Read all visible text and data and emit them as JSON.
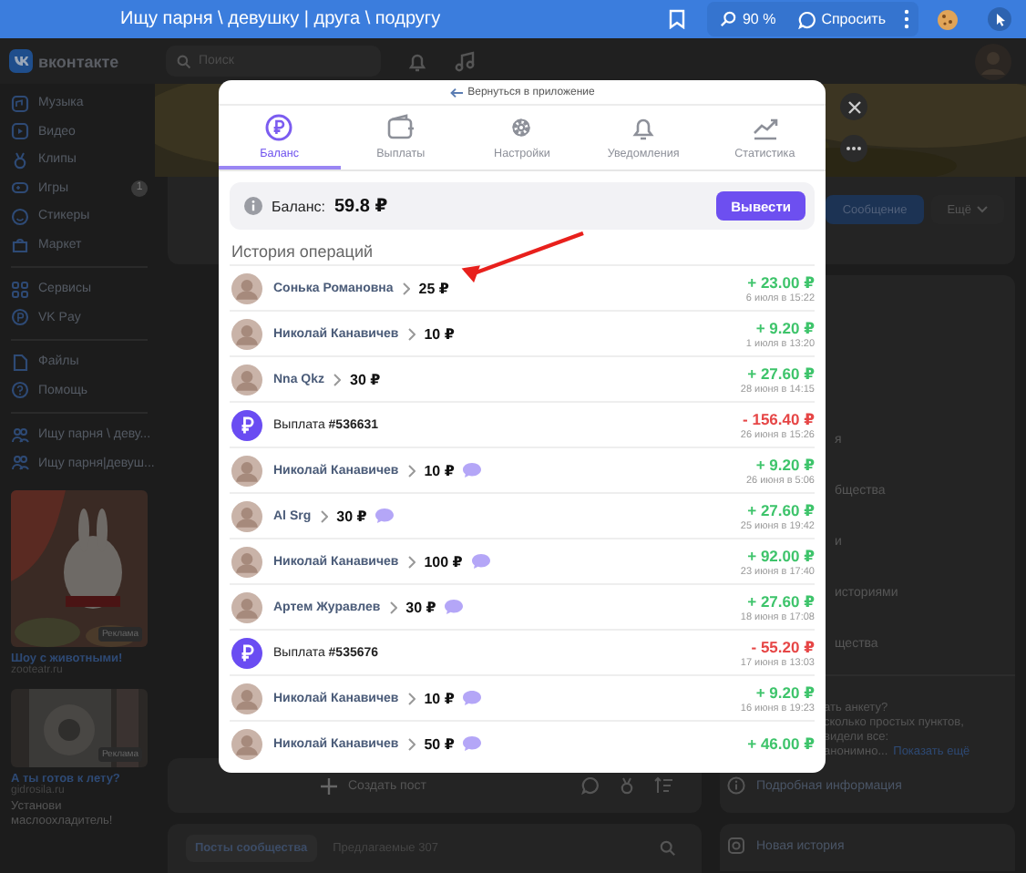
{
  "browser": {
    "title": "Ищу парня \\ девушку | друга \\ подругу",
    "zoom": "90 %",
    "ask": "Спросить"
  },
  "header": {
    "logo": "вконтакте",
    "search": {
      "placeholder": "Поиск"
    }
  },
  "sidebar": {
    "sections": [
      [
        {
          "label": "Музыка"
        },
        {
          "label": "Видео"
        },
        {
          "label": "Клипы"
        },
        {
          "label": "Игры",
          "badge": "1"
        },
        {
          "label": "Стикеры"
        },
        {
          "label": "Маркет"
        }
      ],
      [
        {
          "label": "Сервисы"
        },
        {
          "label": "VK Pay"
        }
      ],
      [
        {
          "label": "Файлы"
        },
        {
          "label": "Помощь"
        }
      ],
      [
        {
          "label": "Ищу парня \\ деву..."
        },
        {
          "label": "Ищу парня|девуш..."
        }
      ]
    ],
    "ads": [
      {
        "label": "Реклама",
        "title": "Шоу с животными!",
        "domain": "zooteatr.ru"
      },
      {
        "label": "Реклама",
        "title": "А ты готов к лету?",
        "domain": "gidrosila.ru",
        "text": "Установи маслоохладитель!"
      }
    ]
  },
  "profile": {
    "buttons": [
      {
        "label": "Сообщение",
        "kind": "primary"
      },
      {
        "label": "Ещё",
        "kind": "menu"
      }
    ]
  },
  "info_panel": {
    "lines": [
      "я",
      "бщества",
      "и",
      "историями",
      "щества"
    ],
    "about": [
      "ать анкету?",
      "сколько простых пунктов,",
      "видели все:"
    ],
    "about_last": "анонимно...",
    "more": "Показать ещё",
    "details": "Подробная информация",
    "story": "Новая история"
  },
  "feed": {
    "create": "Создать пост",
    "tabs": [
      {
        "label": "Посты сообщества",
        "selected": true
      },
      {
        "label": "Предлагаемые",
        "count": "307",
        "selected": false
      }
    ]
  },
  "modal": {
    "back": "Вернуться в приложение",
    "tabs": [
      {
        "label": "Баланс",
        "selected": true
      },
      {
        "label": "Выплаты",
        "selected": false
      },
      {
        "label": "Настройки",
        "selected": false
      },
      {
        "label": "Уведомления",
        "selected": false
      },
      {
        "label": "Статистика",
        "selected": false
      }
    ],
    "balance": {
      "label": "Баланс:",
      "value": "59.8 ₽",
      "button": "Вывести"
    },
    "history_title": "История операций",
    "operations": [
      {
        "kind": "transfer",
        "name": "Сонька Романовна",
        "sum": "25 ₽",
        "comment": false,
        "amount": "+ 23.00 ₽",
        "date": "6 июля в 15:22"
      },
      {
        "kind": "transfer",
        "name": "Николай Канавичев",
        "sum": "10 ₽",
        "comment": false,
        "amount": "+ 9.20 ₽",
        "date": "1 июля в 13:20"
      },
      {
        "kind": "transfer",
        "name": "Nna Qkz",
        "sum": "30 ₽",
        "comment": false,
        "amount": "+ 27.60 ₽",
        "date": "28 июня в 14:15"
      },
      {
        "kind": "payout",
        "title": "Выплата **#536631**",
        "amount": "- 156.40 ₽",
        "date": "26 июня в 15:26"
      },
      {
        "kind": "transfer",
        "name": "Николай Канавичев",
        "sum": "10 ₽",
        "comment": true,
        "amount": "+ 9.20 ₽",
        "date": "26 июня в 5:06"
      },
      {
        "kind": "transfer",
        "name": "Al Srg",
        "sum": "30 ₽",
        "comment": true,
        "amount": "+ 27.60 ₽",
        "date": "25 июня в 19:42"
      },
      {
        "kind": "transfer",
        "name": "Николай Канавичев",
        "sum": "100 ₽",
        "comment": true,
        "amount": "+ 92.00 ₽",
        "date": "23 июня в 17:40"
      },
      {
        "kind": "transfer",
        "name": "Артем Журавлев",
        "sum": "30 ₽",
        "comment": true,
        "amount": "+ 27.60 ₽",
        "date": "18 июня в 17:08"
      },
      {
        "kind": "payout",
        "title": "Выплата **#535676**",
        "amount": "- 55.20 ₽",
        "date": "17 июня в 13:03"
      },
      {
        "kind": "transfer",
        "name": "Николай Канавичев",
        "sum": "10 ₽",
        "comment": true,
        "amount": "+ 9.20 ₽",
        "date": "16 июня в 19:23"
      },
      {
        "kind": "transfer",
        "name": "Николай Канавичев",
        "sum": "50 ₽",
        "comment": true,
        "amount": "+ 46.00 ₽"
      }
    ]
  }
}
